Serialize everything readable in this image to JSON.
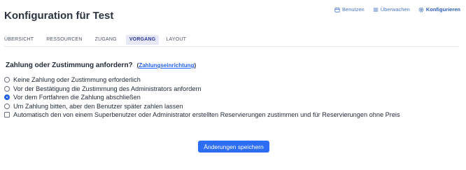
{
  "header": {
    "title": "Konfiguration für Test",
    "links": [
      {
        "label": "Benutzen",
        "icon": "calendar-icon",
        "active": false
      },
      {
        "label": "Überwachen",
        "icon": "list-icon",
        "active": false
      },
      {
        "label": "Konfigurieren",
        "icon": "gear-icon",
        "active": true
      }
    ]
  },
  "tabs": [
    {
      "label": "Übersicht",
      "active": false
    },
    {
      "label": "Ressourcen",
      "active": false
    },
    {
      "label": "Zugang",
      "active": false
    },
    {
      "label": "Vorgang",
      "active": true
    },
    {
      "label": "Layout",
      "active": false
    }
  ],
  "section": {
    "heading": "Zahlung oder Zustimmung anfordern?",
    "link_label": "Zahlungseinrichtung"
  },
  "options": [
    {
      "type": "radio",
      "label": "Keine Zahlung oder Zustimmung erforderlich",
      "checked": false
    },
    {
      "type": "radio",
      "label": "Vor der Bestätigung die Zustimmung des Administrators anfordern",
      "checked": false
    },
    {
      "type": "radio",
      "label": "Vor dem Fortfahren die Zahlung abschließen",
      "checked": true
    },
    {
      "type": "radio",
      "label": "Um Zahlung bitten, aber den Benutzer später zahlen lassen",
      "checked": false
    },
    {
      "type": "checkbox",
      "label": "Automatisch den von einem Superbenutzer oder Administrator erstellten Reservierungen zustimmen und für Reservierungen ohne Preis",
      "checked": false
    }
  ],
  "save_button": {
    "label": "Änderungen speichern"
  },
  "colors": {
    "accent": "#2d6df6",
    "tab_active_bg": "#e7e9f7",
    "link": "#2563eb"
  }
}
